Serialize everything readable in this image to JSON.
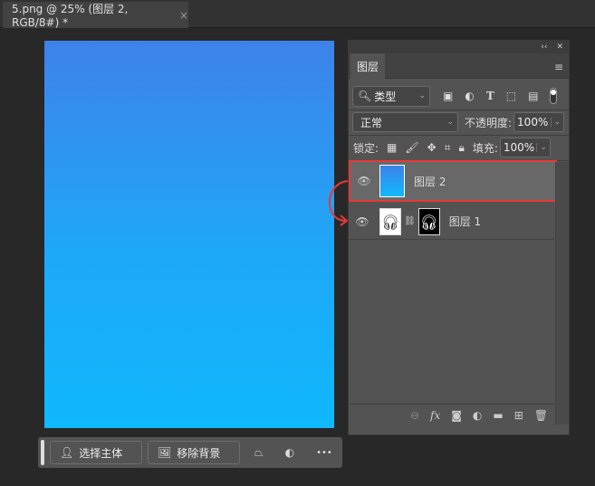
{
  "document": {
    "tab_title": "5.png @ 25% (图层 2, RGB/8#) *",
    "close": "×"
  },
  "panel": {
    "collapse": "‹‹",
    "close": "✕",
    "tab": "图层",
    "menu": "≡",
    "filter": {
      "label": "类型",
      "icons": [
        "image-filter-icon",
        "adjustment-filter-icon",
        "type-filter-icon",
        "shape-filter-icon",
        "smart-object-filter-icon"
      ]
    },
    "blend_mode": "正常",
    "opacity_label": "不透明度:",
    "opacity": "100%",
    "lock_label": "锁定:",
    "fill_label": "填充:",
    "fill": "100%",
    "layers": [
      {
        "name": "图层 2",
        "selected": true
      },
      {
        "name": "图层 1",
        "selected": false
      }
    ]
  },
  "taskbar": {
    "select_subject": "选择主体",
    "remove_bg": "移除背景",
    "more": "•••"
  },
  "colors": {
    "highlight": "#e53935",
    "gradient_top": "#3e82e8",
    "gradient_bottom": "#10b8fc"
  }
}
